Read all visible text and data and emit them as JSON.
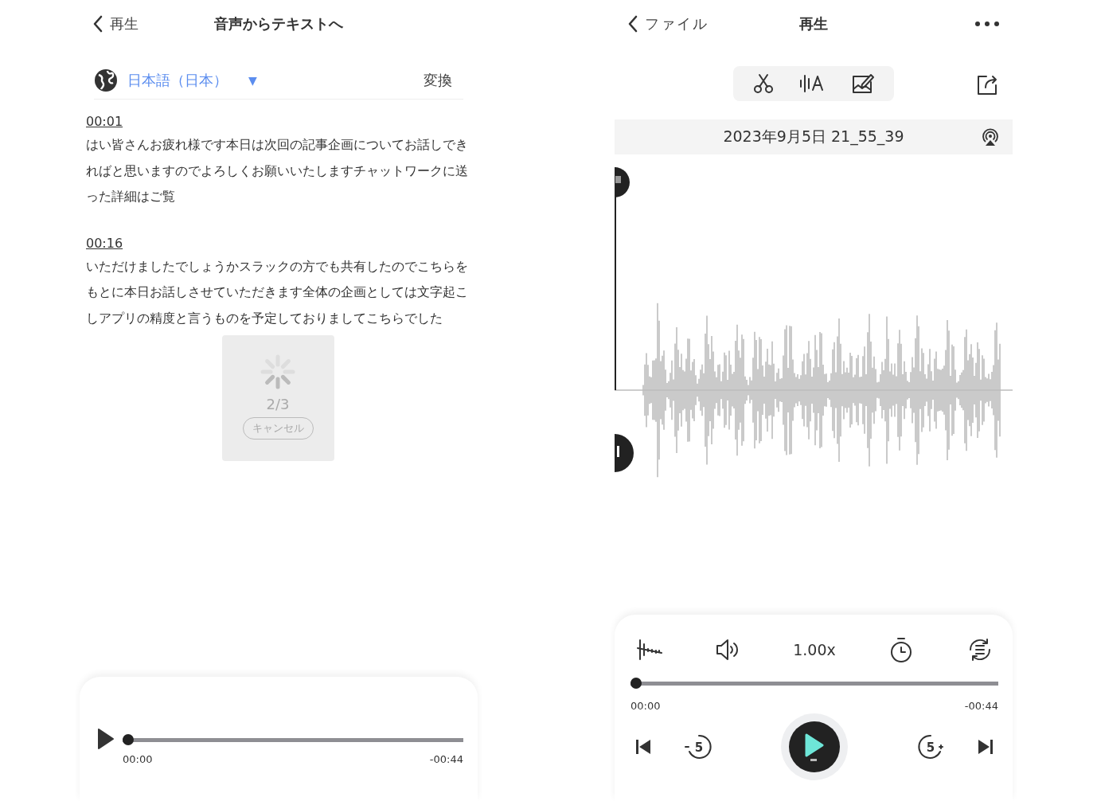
{
  "left": {
    "nav": {
      "back": "再生",
      "title": "音声からテキストへ"
    },
    "language": {
      "label": "日本語（日本）",
      "caret": "▼",
      "action": "変換"
    },
    "segments": [
      {
        "time": "00:01",
        "text": "はい皆さんお疲れ様です本日は次回の記事企画についてお話しできればと思いますのでよろしくお願いいたしますチャットワークに送った詳細はご覧"
      },
      {
        "time": "00:16",
        "text": "いただけましたでしょうかスラックの方でも共有したのでこちらをもとに本日お話しさせていただきます全体の企画としては文字起こしアプリの精度と言うものを予定しておりましてこちらでした"
      }
    ],
    "progress": {
      "count": "2/3",
      "cancel": "キャンセル"
    },
    "player": {
      "level": 0,
      "elapsed": "00:00",
      "remaining": "-00:44"
    }
  },
  "right": {
    "nav": {
      "back": "ファイル",
      "title": "再生"
    },
    "recording": {
      "title": "2023年9月5日 21_55_39"
    },
    "speed": "1.00x",
    "skip": {
      "back": "5",
      "forward": "5"
    },
    "player": {
      "level": 0,
      "elapsed": "00:00",
      "remaining": "-00:44"
    }
  }
}
